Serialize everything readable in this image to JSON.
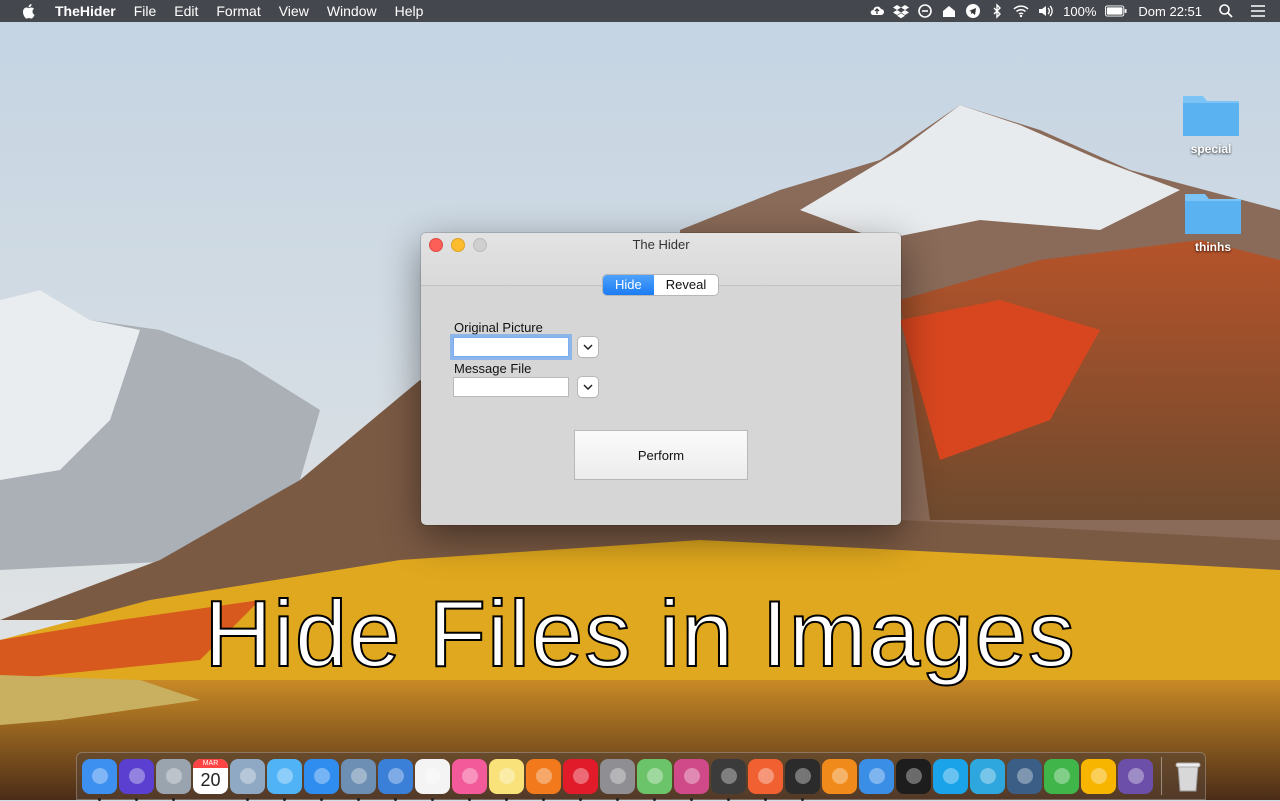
{
  "menubar": {
    "app_name": "TheHider",
    "items": [
      "File",
      "Edit",
      "Format",
      "View",
      "Window",
      "Help"
    ],
    "battery": "100%",
    "clock": "Dom 22:51",
    "status_icons": [
      "cloud-upload-icon",
      "dropbox-icon",
      "sync-icon",
      "home-icon",
      "telegram-icon",
      "bluetooth-icon",
      "wifi-icon",
      "volume-icon",
      "battery-icon",
      "search-icon",
      "list-icon"
    ]
  },
  "desktop": {
    "folders": [
      {
        "label": "special"
      },
      {
        "label": "thinhs"
      }
    ]
  },
  "window": {
    "title": "The Hider",
    "tabs": [
      {
        "label": "Hide",
        "active": true
      },
      {
        "label": "Reveal",
        "active": false
      }
    ],
    "fields": [
      {
        "label": "Original Picture",
        "value": "",
        "focused": true
      },
      {
        "label": "Message File",
        "value": "",
        "focused": false
      }
    ],
    "perform_label": "Perform"
  },
  "headline": "Hide Files in Images",
  "dock": {
    "calendar_month": "MAR",
    "calendar_day": "20",
    "apps": [
      {
        "name": "finder-icon",
        "color": "#3d8ff0"
      },
      {
        "name": "siri-icon",
        "color": "#5b3fd0"
      },
      {
        "name": "launchpad-icon",
        "color": "#9aa4ae"
      },
      {
        "name": "calendar-icon",
        "color": "#ffffff"
      },
      {
        "name": "preview-icon",
        "color": "#8fa9c4"
      },
      {
        "name": "messages-icon",
        "color": "#4fb3f6"
      },
      {
        "name": "safari-icon",
        "color": "#2f8df0"
      },
      {
        "name": "photo-icon",
        "color": "#6d8fb3"
      },
      {
        "name": "keynote-icon",
        "color": "#3a7fd8"
      },
      {
        "name": "texteditor-icon",
        "color": "#f4f4f4"
      },
      {
        "name": "itunes-icon",
        "color": "#f35a9a"
      },
      {
        "name": "notes-icon",
        "color": "#f9e27a"
      },
      {
        "name": "firefox-icon",
        "color": "#f27a1d"
      },
      {
        "name": "opera-icon",
        "color": "#e21b2a"
      },
      {
        "name": "settings-icon",
        "color": "#8e8e93"
      },
      {
        "name": "maps-icon",
        "color": "#6cc46a"
      },
      {
        "name": "pinwheel-icon",
        "color": "#d04a8a"
      },
      {
        "name": "sublime-icon",
        "color": "#3b3b3b"
      },
      {
        "name": "brave-icon",
        "color": "#f06030"
      },
      {
        "name": "activity-monitor-icon",
        "color": "#2b2b2b"
      },
      {
        "name": "books-icon",
        "color": "#f08a1a"
      },
      {
        "name": "xcode-icon",
        "color": "#3a8ee6"
      },
      {
        "name": "terminal-icon",
        "color": "#1d1d1d"
      },
      {
        "name": "skype-icon",
        "color": "#1aa3e8"
      },
      {
        "name": "telegram-icon",
        "color": "#2ea6de"
      },
      {
        "name": "quicktime-icon",
        "color": "#3b5e86"
      },
      {
        "name": "numbers-icon",
        "color": "#3fb54a"
      },
      {
        "name": "sketch-icon",
        "color": "#f7b500"
      },
      {
        "name": "image-search-icon",
        "color": "#6b4fa8"
      }
    ],
    "trash": {
      "name": "trash-icon",
      "color": "#d8d8d8"
    }
  }
}
